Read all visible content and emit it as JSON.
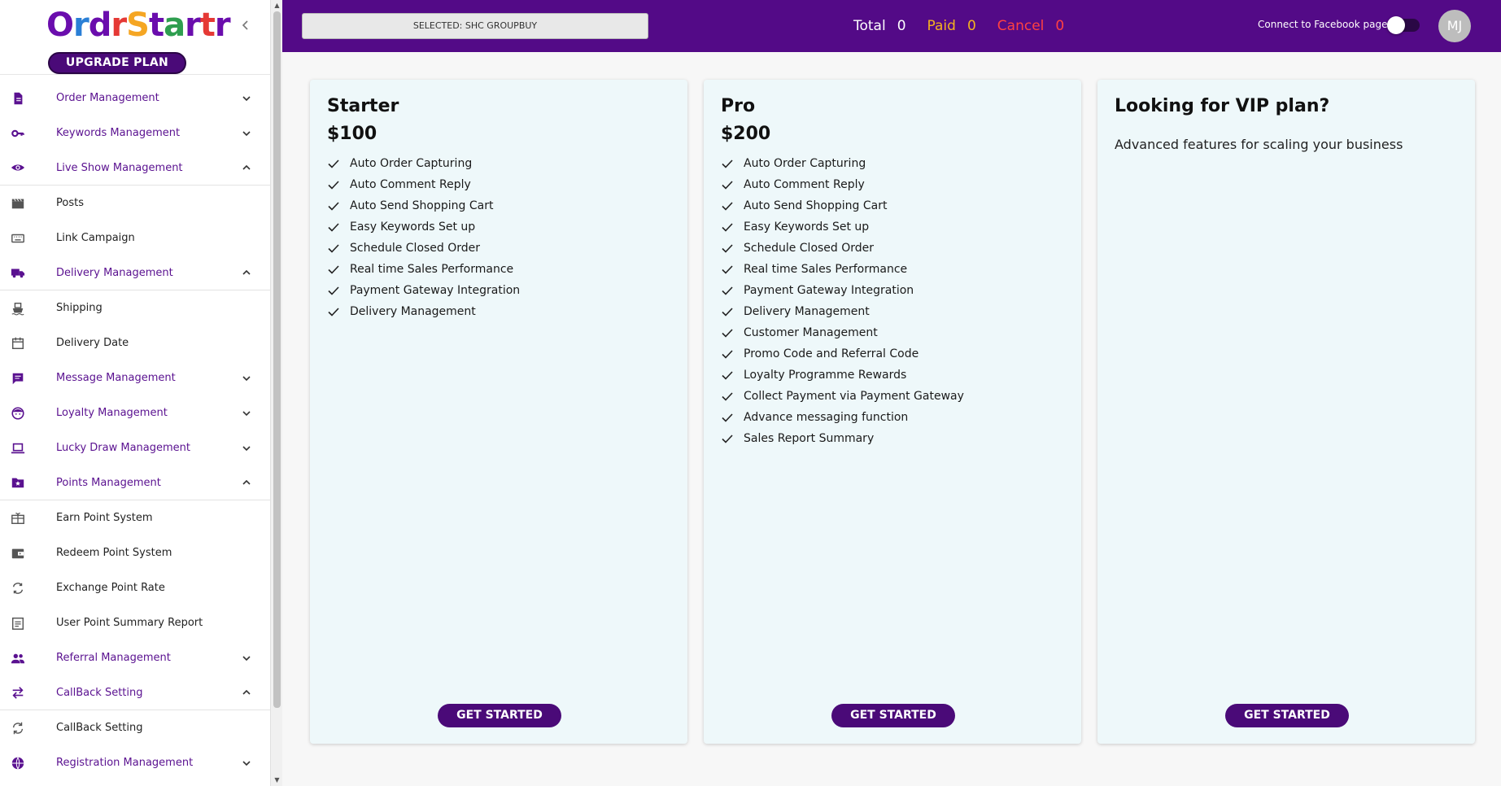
{
  "brand": {
    "logo_letters": [
      {
        "ch": "O",
        "color": "#6a0dad"
      },
      {
        "ch": "r",
        "color": "#2a7fd6"
      },
      {
        "ch": "d",
        "color": "#6a0dad"
      },
      {
        "ch": "r",
        "color": "#e53935"
      },
      {
        "ch": "S",
        "color": "#f5a623"
      },
      {
        "ch": "t",
        "color": "#6a0dad"
      },
      {
        "ch": "a",
        "color": "#2e9e4f"
      },
      {
        "ch": "r",
        "color": "#6a0dad"
      },
      {
        "ch": "t",
        "color": "#e53935"
      },
      {
        "ch": "r",
        "color": "#6a0dad"
      }
    ],
    "upgrade_label": "UPGRADE PLAN"
  },
  "sidebar": {
    "items": [
      {
        "label": "Order Management",
        "type": "parent",
        "icon": "document-icon",
        "chevron": "down"
      },
      {
        "label": "Keywords Management",
        "type": "parent",
        "icon": "key-icon",
        "chevron": "down"
      },
      {
        "label": "Live Show Management",
        "type": "parent",
        "icon": "eye-icon",
        "chevron": "up"
      },
      {
        "label": "Posts",
        "type": "child",
        "icon": "clapperboard-icon"
      },
      {
        "label": "Link Campaign",
        "type": "child",
        "icon": "keyboard-icon"
      },
      {
        "label": "Delivery Management",
        "type": "parent",
        "icon": "truck-icon",
        "chevron": "up"
      },
      {
        "label": "Shipping",
        "type": "child",
        "icon": "ship-icon"
      },
      {
        "label": "Delivery Date",
        "type": "child",
        "icon": "calendar-icon"
      },
      {
        "label": "Message Management",
        "type": "parent",
        "icon": "message-icon",
        "chevron": "down"
      },
      {
        "label": "Loyalty Management",
        "type": "parent",
        "icon": "face-icon",
        "chevron": "down"
      },
      {
        "label": "Lucky Draw Management",
        "type": "parent",
        "icon": "laptop-icon",
        "chevron": "down"
      },
      {
        "label": "Points Management",
        "type": "parent",
        "icon": "folder-star-icon",
        "chevron": "up"
      },
      {
        "label": "Earn Point System",
        "type": "child",
        "icon": "gift-card-icon"
      },
      {
        "label": "Redeem Point System",
        "type": "child",
        "icon": "wallet-icon"
      },
      {
        "label": "Exchange Point Rate",
        "type": "child",
        "icon": "exchange-icon"
      },
      {
        "label": "User Point Summary Report",
        "type": "child",
        "icon": "report-icon"
      },
      {
        "label": "Referral Management",
        "type": "parent",
        "icon": "people-icon",
        "chevron": "down"
      },
      {
        "label": "CallBack Setting",
        "type": "parent",
        "icon": "swap-icon",
        "chevron": "up"
      },
      {
        "label": "CallBack Setting",
        "type": "child",
        "icon": "sync-icon"
      },
      {
        "label": "Registration Management",
        "type": "parent",
        "icon": "globe-icon",
        "chevron": "down"
      }
    ]
  },
  "header": {
    "selected_label": "SELECTED: SHC GROUPBUY",
    "total_label": "Total",
    "total_value": "0",
    "paid_label": "Paid",
    "paid_value": "0",
    "cancel_label": "Cancel",
    "cancel_value": "0",
    "facebook_label": "Connect to Facebook page",
    "avatar_initials": "MJ"
  },
  "colors": {
    "brand_purple": "#530a87",
    "button_purple": "#4a0a78",
    "paid": "#f5b31f",
    "cancel": "#ff4141",
    "card_bg": "#eef8fa"
  },
  "plans": [
    {
      "title": "Starter",
      "price": "$100",
      "features": [
        "Auto Order Capturing",
        "Auto Comment Reply",
        "Auto Send Shopping Cart",
        "Easy Keywords Set up",
        "Schedule Closed Order",
        "Real time Sales Performance",
        "Payment Gateway Integration",
        "Delivery Management"
      ],
      "button": "GET STARTED"
    },
    {
      "title": "Pro",
      "price": "$200",
      "features": [
        "Auto Order Capturing",
        "Auto Comment Reply",
        "Auto Send Shopping Cart",
        "Easy Keywords Set up",
        "Schedule Closed Order",
        "Real time Sales Performance",
        "Payment Gateway Integration",
        "Delivery Management",
        "Customer Management",
        "Promo Code and Referral Code",
        "Loyalty Programme Rewards",
        "Collect Payment via Payment Gateway",
        "Advance messaging function",
        "Sales Report Summary"
      ],
      "button": "GET STARTED"
    },
    {
      "title": "Looking for VIP plan?",
      "description": "Advanced features for scaling your business",
      "button": "GET STARTED"
    }
  ]
}
